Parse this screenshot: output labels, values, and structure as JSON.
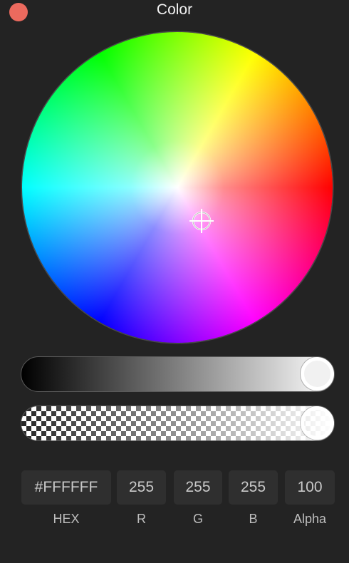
{
  "window": {
    "title": "Color"
  },
  "color": {
    "hex": "#FFFFFF",
    "r": "255",
    "g": "255",
    "b": "255",
    "alpha": "100",
    "brightness_level": 1.0,
    "alpha_level": 1.0
  },
  "labels": {
    "hex": "HEX",
    "r": "R",
    "g": "G",
    "b": "B",
    "alpha": "Alpha"
  },
  "colors": {
    "background": "#232323",
    "close": "#ec6a5e",
    "field": "#2f2f2f"
  }
}
